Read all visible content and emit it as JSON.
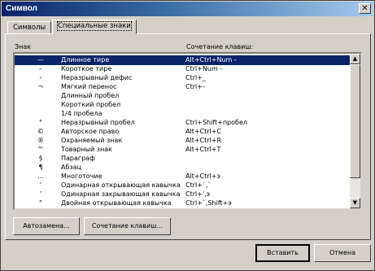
{
  "window": {
    "title": "Символ",
    "close_glyph": "✕"
  },
  "tabs": [
    {
      "label": "Символы",
      "active": false
    },
    {
      "label": "Специальные знаки",
      "active": true
    }
  ],
  "list": {
    "col_symbol": "Знак",
    "col_shortcut": "Сочетание клавиш:",
    "rows": [
      {
        "symbol": "—",
        "name": "Длинное тире",
        "shortcut": "Alt+Ctrl+Num -",
        "selected": true
      },
      {
        "symbol": "–",
        "name": "Короткое тире",
        "shortcut": "Ctrl+Num -"
      },
      {
        "symbol": "-",
        "name": "Неразрывный дефис",
        "shortcut": "Ctrl+_"
      },
      {
        "symbol": "¬",
        "name": "Мягкий перенос",
        "shortcut": "Ctrl+-"
      },
      {
        "symbol": "",
        "name": "Длинный пробел",
        "shortcut": ""
      },
      {
        "symbol": "",
        "name": "Короткий пробел",
        "shortcut": ""
      },
      {
        "symbol": "",
        "name": "1/4 пробела",
        "shortcut": ""
      },
      {
        "symbol": "°",
        "name": "Неразрывный пробел",
        "shortcut": "Ctrl+Shift+пробел"
      },
      {
        "symbol": "©",
        "name": "Авторское право",
        "shortcut": "Alt+Ctrl+C"
      },
      {
        "symbol": "®",
        "name": "Охраняемый знак",
        "shortcut": "Alt+Ctrl+R"
      },
      {
        "symbol": "™",
        "name": "Товарный знак",
        "shortcut": "Alt+Ctrl+T"
      },
      {
        "symbol": "§",
        "name": "Параграф",
        "shortcut": ""
      },
      {
        "symbol": "¶",
        "name": "Абзац",
        "shortcut": ""
      },
      {
        "symbol": "…",
        "name": "Многоточие",
        "shortcut": "Alt+Ctrl+э"
      },
      {
        "symbol": "‘",
        "name": "Одинарная открывающая кавычка",
        "shortcut": "Ctrl+`,`"
      },
      {
        "symbol": "’",
        "name": "Одинарная закрывающая кавычка",
        "shortcut": "Ctrl+',э"
      },
      {
        "symbol": "“",
        "name": "Двойная открывающая кавычка",
        "shortcut": "Ctrl+`,Shift+э"
      }
    ]
  },
  "buttons": {
    "autocorrect": "Автозамена...",
    "shortcut": "Сочетание клавиш...",
    "insert": "Вставить",
    "cancel": "Отмена"
  },
  "scrollbar": {
    "up_glyph": "▲",
    "down_glyph": "▼"
  }
}
